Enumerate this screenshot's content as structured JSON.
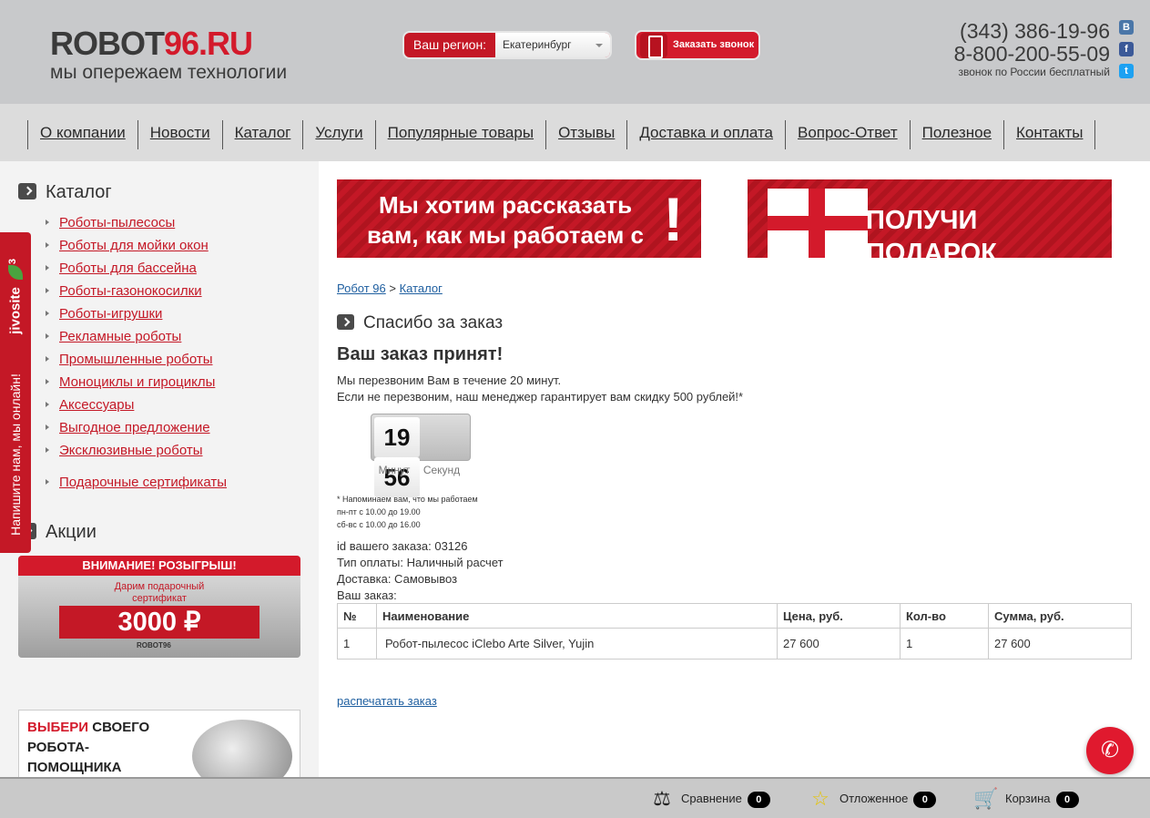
{
  "header": {
    "logo_prefix": "ROBOT",
    "logo_suffix": "96.RU",
    "tagline": "мы опережаем технологии",
    "region_label": "Ваш регион:",
    "region_value": "Екатеринбург",
    "call_button": "Заказать звонок",
    "phone1": "(343) 386-19-96",
    "phone2": "8-800-200-55-09",
    "phone_note": "звонок по России бесплатный",
    "social": [
      "vk-icon",
      "facebook-icon",
      "twitter-icon"
    ]
  },
  "nav": [
    "О компании",
    "Новости",
    "Каталог",
    "Услуги",
    "Популярные товары",
    "Отзывы",
    "Доставка и оплата",
    "Вопрос-Ответ",
    "Полезное",
    "Контакты"
  ],
  "sidebar": {
    "catalog_title": "Каталог",
    "catalog_items": [
      "Роботы-пылесосы",
      "Роботы для мойки окон",
      "Роботы для бассейна",
      "Роботы-газонокосилки",
      "Роботы-игрушки",
      "Рекламные роботы",
      "Промышленные роботы",
      "Моноциклы и гироциклы",
      "Аксессуары",
      "Выгодное предложение",
      "Эксклюзивные роботы"
    ],
    "catalog_extra": "Подарочные сертификаты",
    "promo_title": "Акции",
    "promo1_header": "ВНИМАНИЕ! РОЗЫГРЫШ!",
    "promo1_text": "Дарим подарочный сертификат",
    "promo1_amount": "3000 ₽",
    "promo1_logo": "ROBOT96",
    "promo2_red": "ВЫБЕРИ",
    "promo2_rest1": "СВОЕГО",
    "promo2_rest2": "РОБОТА-",
    "promo2_rest3": "ПОМОЩНИКА"
  },
  "jivosite": {
    "brand": "jivosite",
    "message": "Напишите нам, мы онлайн!"
  },
  "banners": {
    "left": "Мы хотим рассказать вам, как мы работаем с вами",
    "left_mark": "!",
    "right": "ПОЛУЧИ ПОДАРОК"
  },
  "breadcrumb": {
    "home": "Робот 96",
    "sep": ">",
    "current": "Каталог"
  },
  "page": {
    "title": "Спасибо за заказ",
    "accepted": "Ваш заказ принят!",
    "msg1": "Мы перезвоним Вам в течение 20 минут.",
    "msg2": "Если не перезвоним, наш менеджер гарантирует вам скидку 500 рублей!*",
    "timer_min": "19",
    "timer_sec": "56",
    "timer_min_label": "Минут",
    "timer_sec_label": "Секунд",
    "hours1": "* Напоминаем вам, что мы работаем",
    "hours2": "пн-пт с 10.00 до 19.00",
    "hours3": "сб-вс с 10.00 до 16.00",
    "order_id": "id вашего заказа: 03126",
    "payment": "Тип оплаты: Наличный расчет",
    "delivery": "Доставка: Самовывоз",
    "order_label": "Ваш заказ:",
    "print_link": "распечатать заказ"
  },
  "table": {
    "headers": [
      "№",
      "Наименование",
      "Цена, руб.",
      "Кол-во",
      "Сумма, руб."
    ],
    "rows": [
      [
        "1",
        "Робот-пылесос iClebo Arte Silver, Yujin",
        "27 600",
        "1",
        "27 600"
      ]
    ]
  },
  "bottom_bar": {
    "compare_label": "Сравнение",
    "compare_count": "0",
    "deferred_label": "Отложенное",
    "deferred_count": "0",
    "cart_label": "Корзина",
    "cart_count": "0"
  },
  "colors": {
    "brand_red": "#c41826",
    "header_gray": "#c8c9cb",
    "link_blue": "#1f5fa0"
  }
}
